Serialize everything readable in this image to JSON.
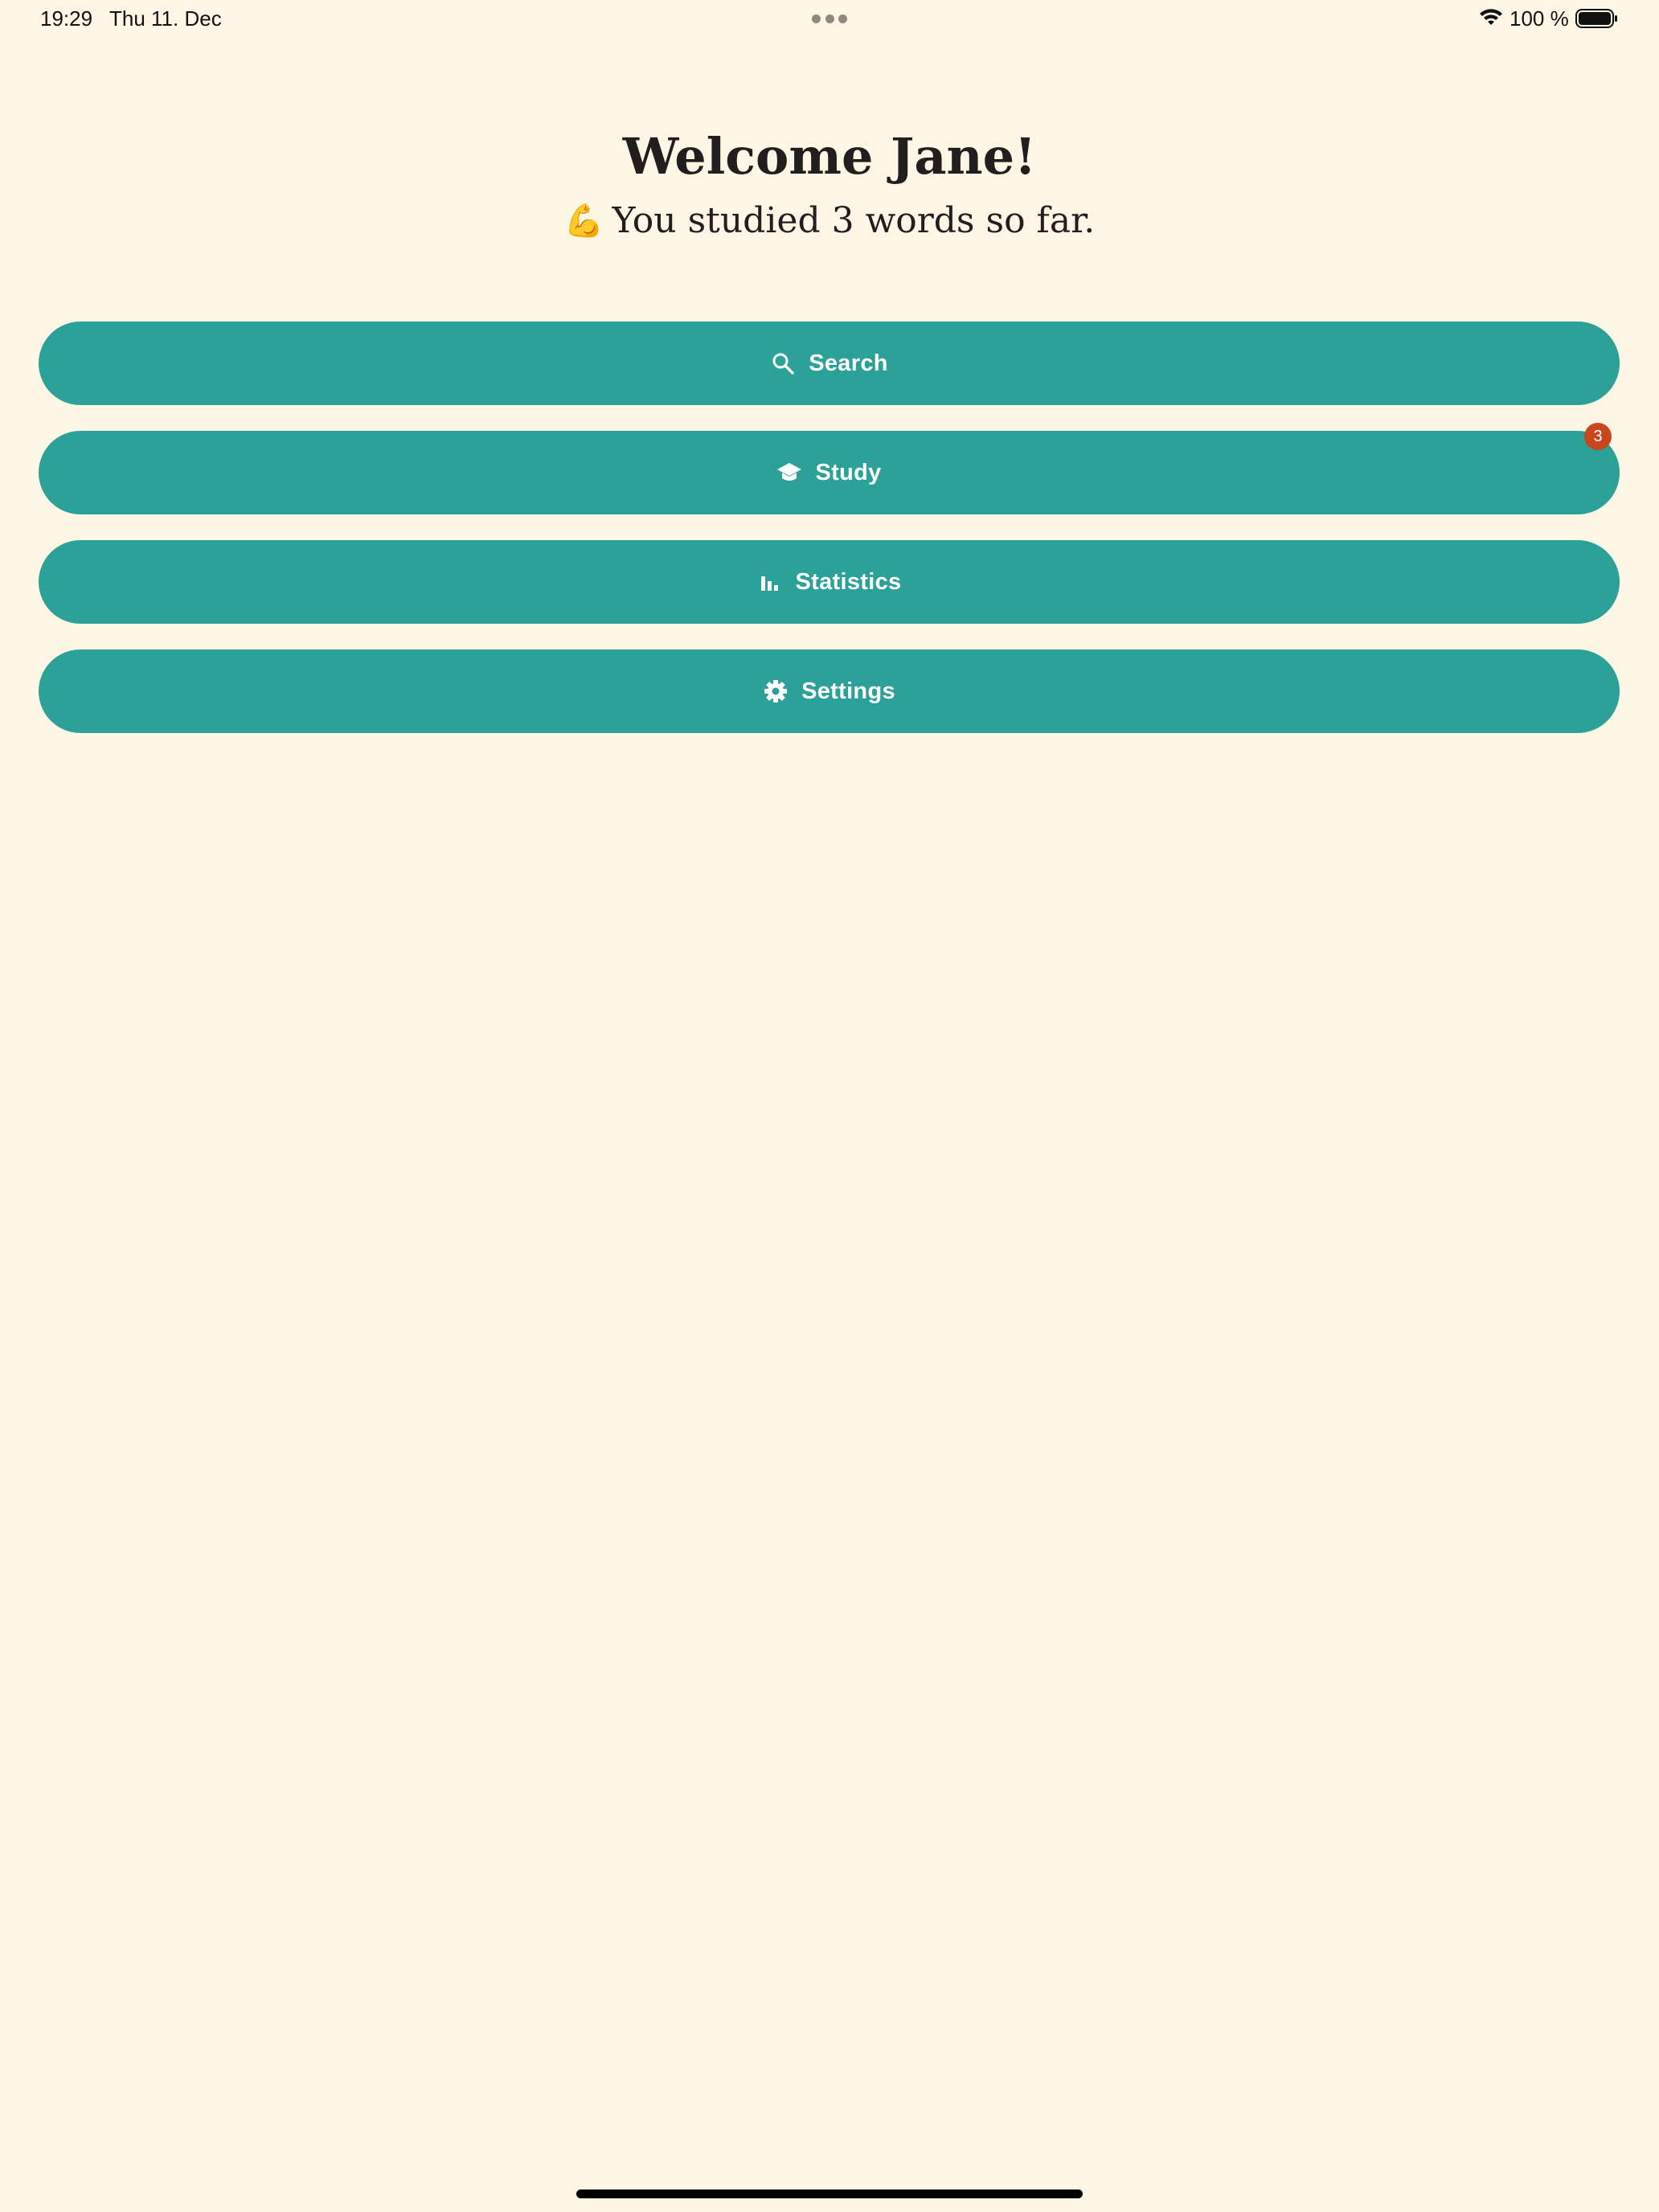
{
  "status_bar": {
    "time": "19:29",
    "date": "Thu 11. Dec",
    "battery": "100 %"
  },
  "header": {
    "title": "Welcome Jane!",
    "emoji": "💪",
    "subtitle": "You studied 3 words so far."
  },
  "menu": {
    "items": [
      {
        "label": "Search",
        "icon": "search-icon"
      },
      {
        "label": "Study",
        "icon": "graduation-cap-icon",
        "badge": "3"
      },
      {
        "label": "Statistics",
        "icon": "bar-chart-icon"
      },
      {
        "label": "Settings",
        "icon": "gear-icon"
      }
    ]
  },
  "colors": {
    "background": "#fdf6e4",
    "button": "#2ba198",
    "badge": "#c9461e",
    "text": "#221e1e"
  }
}
